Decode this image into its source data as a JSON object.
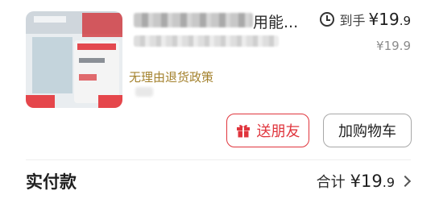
{
  "product": {
    "title_visible_suffix": "用能...",
    "policy_note": "无理由退货政策"
  },
  "price": {
    "label": "到手",
    "currency": "¥",
    "int": "19",
    "dec": ".9",
    "original": "¥19.9"
  },
  "actions": {
    "gift_label": "送朋友",
    "cart_label": "加购物车"
  },
  "summary": {
    "paid_label": "实付款",
    "total_label": "合计",
    "currency": "¥",
    "total_int": "19",
    "total_dec": ".9"
  },
  "colors": {
    "accent_red": "#e0353d",
    "policy_gold": "#a4822e"
  }
}
